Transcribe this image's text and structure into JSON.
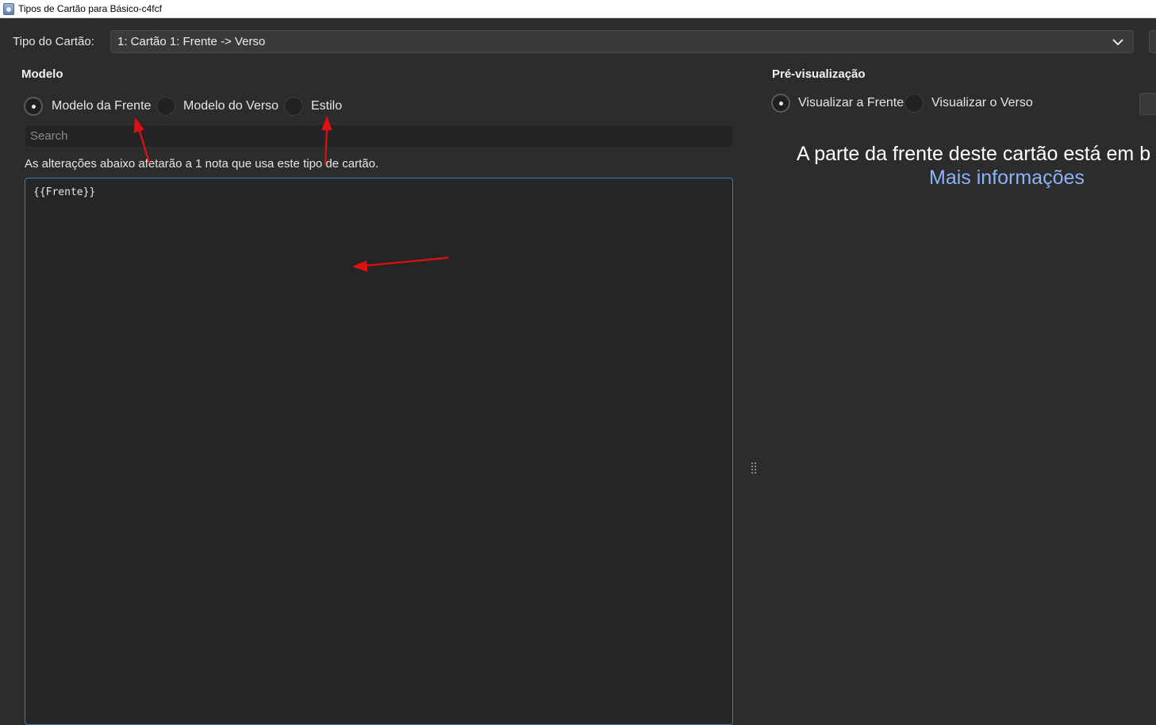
{
  "window": {
    "title": "Tipos de Cartão para Básico-c4fcf"
  },
  "card_type": {
    "label": "Tipo do Cartão:",
    "value": "1: Cartão 1: Frente -> Verso"
  },
  "template": {
    "title": "Modelo",
    "options": [
      {
        "label": "Modelo da Frente",
        "checked": true
      },
      {
        "label": "Modelo do Verso",
        "checked": false
      },
      {
        "label": "Estilo",
        "checked": false
      }
    ],
    "search_placeholder": "Search",
    "info": "As alterações abaixo afetarão a 1 nota que usa este tipo de cartão.",
    "content": "{{Frente}}"
  },
  "preview": {
    "title": "Pré-visualização",
    "options": [
      {
        "label": "Visualizar a Frente",
        "checked": true
      },
      {
        "label": "Visualizar o Verso",
        "checked": false
      }
    ],
    "message": "A parte da frente deste cartão está em b",
    "link": "Mais informações"
  },
  "colors": {
    "background": "#2c2c2c",
    "editor_border": "#3b79c6",
    "link": "#8ab4f8",
    "annotation_arrow": "#e01010"
  }
}
